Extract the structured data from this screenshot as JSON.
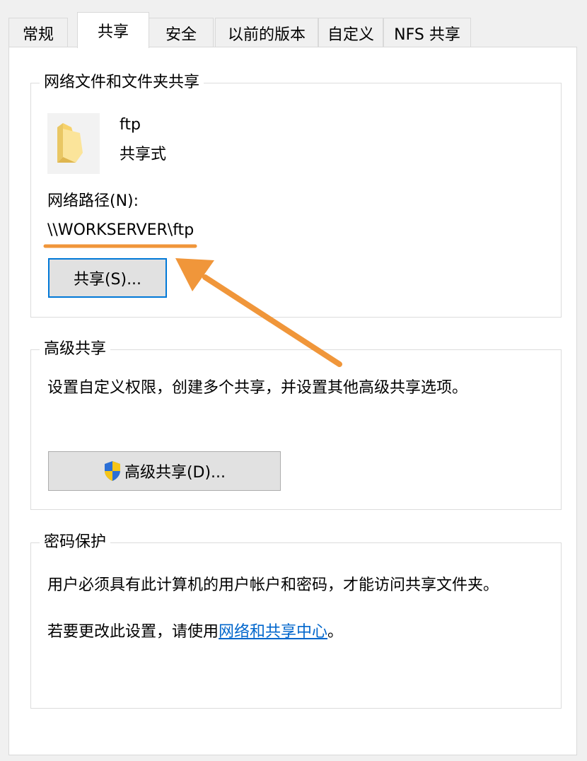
{
  "tabs": [
    {
      "label": "常规",
      "active": false
    },
    {
      "label": "共享",
      "active": true
    },
    {
      "label": "安全",
      "active": false
    },
    {
      "label": "以前的版本",
      "active": false
    },
    {
      "label": "自定义",
      "active": false
    },
    {
      "label": "NFS 共享",
      "active": false
    }
  ],
  "network_sharing": {
    "title": "网络文件和文件夹共享",
    "folder_icon": "folder-icon",
    "folder_name": "ftp",
    "share_state": "共享式",
    "path_label": "网络路径(N):",
    "path_value": "\\\\WORKSERVER\\ftp",
    "share_button": "共享(S)..."
  },
  "advanced_sharing": {
    "title": "高级共享",
    "description": "设置自定义权限，创建多个共享，并设置其他高级共享选项。",
    "button_icon": "shield-icon",
    "button_label": "高级共享(D)..."
  },
  "password_protection": {
    "title": "密码保护",
    "description": "用户必须具有此计算机的用户帐户和密码，才能访问共享文件夹。",
    "change_prefix": "若要更改此设置，请使用",
    "change_link": "网络和共享中心",
    "change_suffix": "。"
  },
  "annotation": {
    "accent_color": "#f0963a"
  }
}
